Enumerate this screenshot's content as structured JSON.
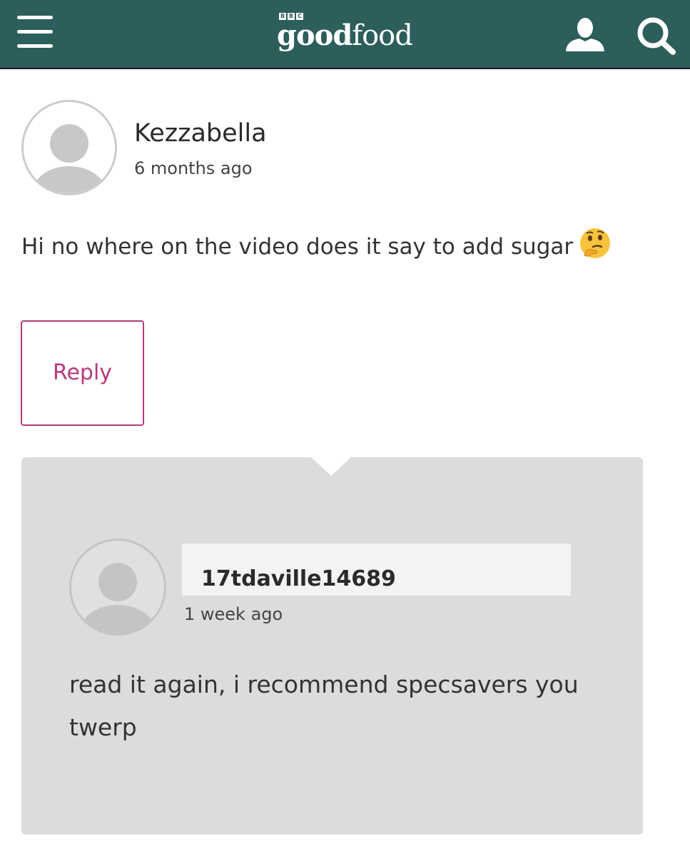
{
  "header": {
    "menu_icon": "hamburger-menu-icon",
    "logo": {
      "bbc": [
        "B",
        "B",
        "C"
      ],
      "word_bold": "good",
      "word_regular": "food"
    },
    "account_icon": "user-account-icon",
    "search_icon": "search-icon",
    "background_color": "#2c5e5b"
  },
  "comment": {
    "author": "Kezzabella",
    "timestamp": "6 months ago",
    "text": "Hi no where on the video does it say to add sugar",
    "emoji": "thinking-face-emoji",
    "reply_label": "Reply",
    "accent_color": "#b83b7a"
  },
  "reply": {
    "author": "17tdaville14689",
    "timestamp": "1 week ago",
    "text": "read it again, i recommend specsavers you twerp",
    "panel_color": "#dcdcdc"
  }
}
